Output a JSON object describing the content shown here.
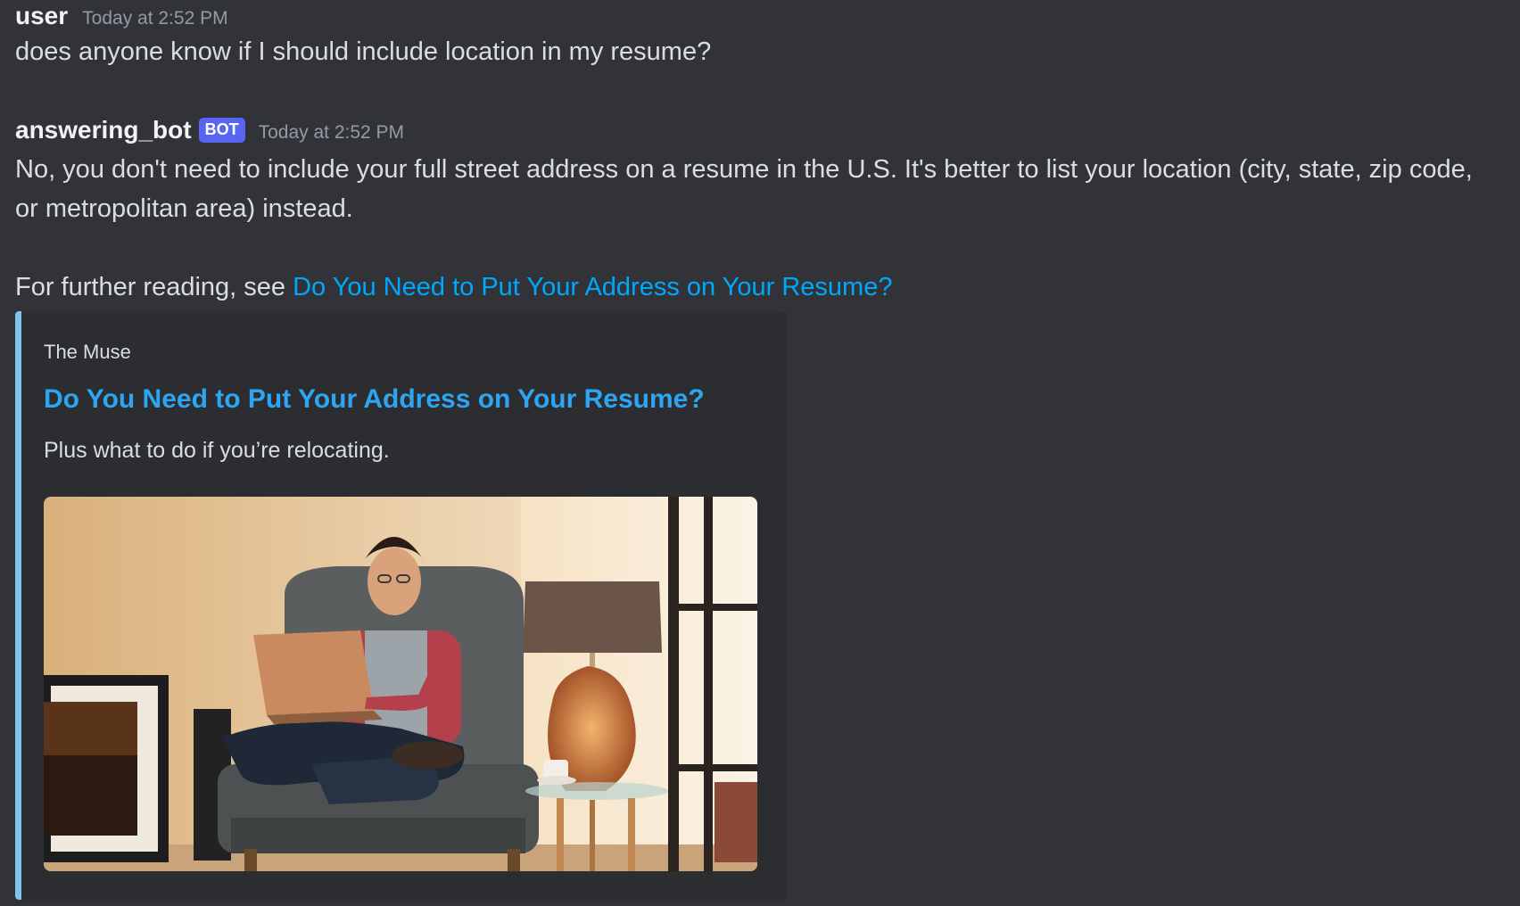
{
  "messages": [
    {
      "author": "user",
      "timestamp": "Today at 2:52 PM",
      "text": "does anyone know if I should include location in my resume?"
    },
    {
      "author": "answering_bot",
      "badge": "BOT",
      "timestamp": "Today at 2:52 PM",
      "paragraph1": "No, you don't need to include your full street address on a resume in the U.S. It's better to list your location (city, state, zip code, or metropolitan area) instead.",
      "paragraph2_prefix": "For further reading, see ",
      "paragraph2_link": "Do You Need to Put Your Address on Your Resume?"
    }
  ],
  "embed": {
    "provider": "The Muse",
    "title": "Do You Need to Put Your Address on Your Resume?",
    "description": "Plus what to do if you’re relocating.",
    "accent_color": "#7cc5f1",
    "image_alt": "man-with-laptop-in-armchair"
  },
  "colors": {
    "background": "#313338",
    "embed_background": "#2b2d31",
    "link": "#00a8fc",
    "bot_badge": "#5865f2"
  }
}
